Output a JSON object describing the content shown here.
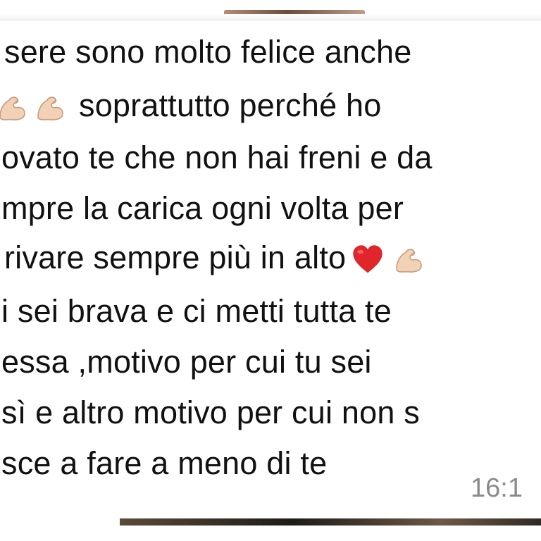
{
  "message": {
    "lines": [
      "sere sono molto felice anche",
      "soprattutto perché ho",
      "ovato te che non hai freni e da",
      "mpre la carica ogni volta per",
      "rivare sempre più in alto",
      "i sei brava e ci metti tutta te",
      "essa ,motivo per cui tu sei",
      "sì e altro motivo per cui non s",
      "sce a fare a meno di te"
    ],
    "timestamp": "16:1",
    "emojis": [
      "flexed-biceps",
      "flexed-biceps",
      "red-heart",
      "flexed-biceps"
    ]
  },
  "colors": {
    "text": "#111111",
    "timestamp": "#8a8a8a",
    "bubble": "#ffffff",
    "heart": "#e0262b",
    "skin": "#f2d2b6"
  }
}
